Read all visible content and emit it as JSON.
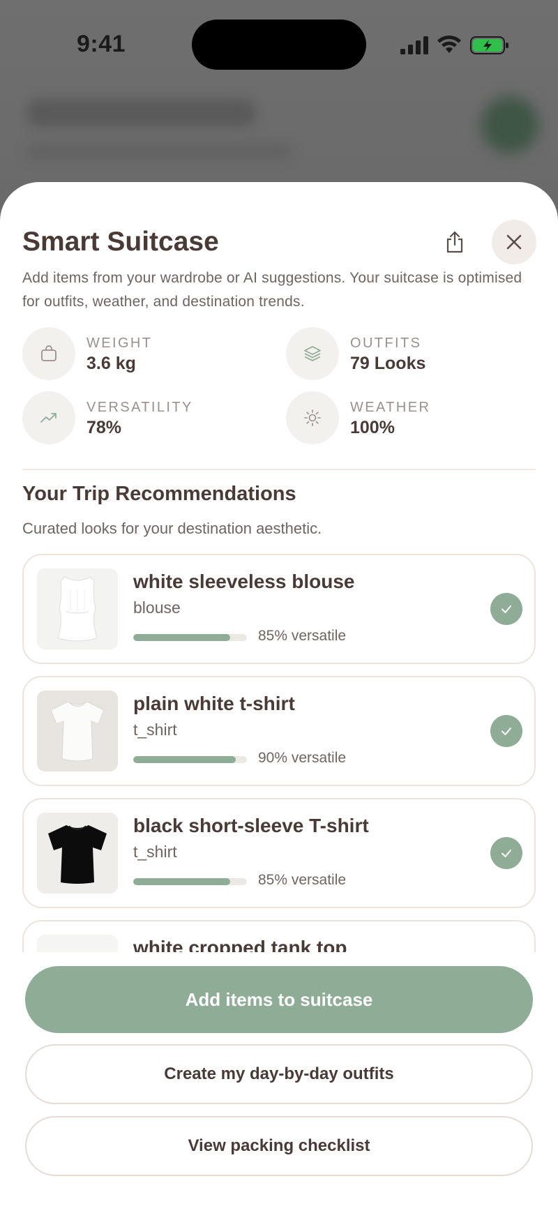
{
  "status_bar": {
    "time": "9:41"
  },
  "sheet": {
    "title": "Smart Suitcase",
    "description": "Add items from your wardrobe or AI suggestions. Your suitcase is optimised for outfits, weather, and destination trends."
  },
  "stats": [
    {
      "label": "WEIGHT",
      "value": "3.6 kg",
      "icon": "bag-icon"
    },
    {
      "label": "OUTFITS",
      "value": "79 Looks",
      "icon": "layers-icon"
    },
    {
      "label": "VERSATILITY",
      "value": "78%",
      "icon": "trending-up-icon"
    },
    {
      "label": "WEATHER",
      "value": "100%",
      "icon": "sun-icon"
    }
  ],
  "recommendations": {
    "title": "Your Trip Recommendations",
    "subtitle": "Curated looks for your destination aesthetic.",
    "items": [
      {
        "name": "white sleeveless blouse",
        "type": "blouse",
        "versatility_pct": 85,
        "versatility_text": "85% versatile",
        "selected": true
      },
      {
        "name": "plain white t-shirt",
        "type": "t_shirt",
        "versatility_pct": 90,
        "versatility_text": "90% versatile",
        "selected": true
      },
      {
        "name": "black short-sleeve T-shirt",
        "type": "t_shirt",
        "versatility_pct": 85,
        "versatility_text": "85% versatile",
        "selected": true
      },
      {
        "name": "white cropped tank top",
        "type": "",
        "versatility_pct": null,
        "versatility_text": "",
        "selected": false
      }
    ]
  },
  "actions": {
    "primary": "Add items to suitcase",
    "outfits": "Create my day-by-day outfits",
    "checklist": "View packing checklist"
  },
  "colors": {
    "accent": "#8fad96",
    "text": "#4a3a36",
    "muted": "#6e6461",
    "border": "#eee4dc"
  }
}
